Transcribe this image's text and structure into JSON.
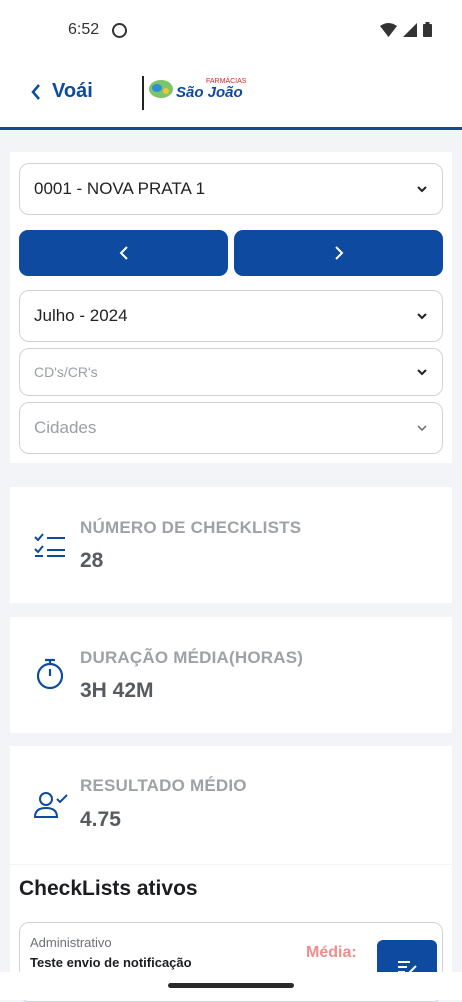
{
  "status_bar": {
    "time": "6:52"
  },
  "header": {
    "app_logo": "Voái",
    "partner_top": "FARMÁCIAS",
    "partner_name": "São João"
  },
  "filters": {
    "store": "0001 - NOVA PRATA 1",
    "period": "Julho - 2024",
    "cds_placeholder": "CD's/CR's",
    "cities_placeholder": "Cidades"
  },
  "stats": [
    {
      "title": "NÚMERO DE CHECKLISTS",
      "value": "28",
      "icon": "checklist-icon"
    },
    {
      "title": "DURAÇÃO MÉDIA(HORAS)",
      "value": "3H 42M",
      "icon": "stopwatch-icon"
    },
    {
      "title": "RESULTADO MÉDIO",
      "value": "4.75",
      "icon": "user-check-icon"
    }
  ],
  "active_checklists": {
    "title": "CheckLists ativos",
    "items": [
      {
        "category": "Administrativo",
        "name": "Teste envio de notificação",
        "media_label": "Média:"
      }
    ]
  },
  "colors": {
    "primary": "#0d4aa0",
    "accent_red": "#d8262a",
    "media_label": "#f28c8c"
  }
}
